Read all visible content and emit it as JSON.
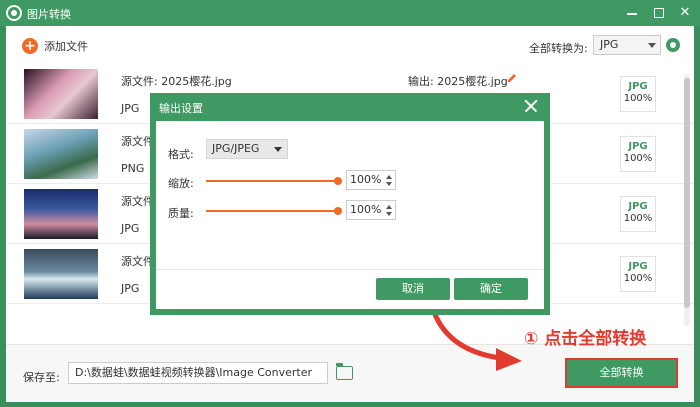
{
  "window": {
    "title": "图片转换",
    "minimize_icon": "minimize-icon",
    "maximize_icon": "maximize-icon",
    "close_icon": "close-icon"
  },
  "toolbar": {
    "add_files_label": "添加文件",
    "convert_all_to_label": "全部转换为:",
    "format_value": "JPG"
  },
  "files": [
    {
      "source": "源文件: 2025樱花.jpg",
      "format": "JPG",
      "output": "输出: 2025樱花.jpg",
      "badge_format": "JPG",
      "badge_quality": "100%"
    },
    {
      "source": "源文件",
      "format": "PNG",
      "output": "",
      "badge_format": "JPG",
      "badge_quality": "100%"
    },
    {
      "source": "源文件",
      "format": "JPG",
      "output": "",
      "badge_format": "JPG",
      "badge_quality": "100%"
    },
    {
      "source": "源文件",
      "format": "JPG",
      "output": "",
      "badge_format": "JPG",
      "badge_quality": "100%"
    }
  ],
  "bottom": {
    "save_to_label": "保存至:",
    "save_path": "D:\\数据蛙\\数据蛙视频转换器\\Image Converter",
    "convert_all_button": "全部转换"
  },
  "annotation": "① 点击全部转换",
  "dialog": {
    "title": "输出设置",
    "format_label": "格式:",
    "format_value": "JPG/JPEG",
    "scale_label": "缩放:",
    "scale_value": "100%",
    "scale_level": 1.0,
    "quality_label": "质量:",
    "quality_value": "100%",
    "quality_level": 1.0,
    "cancel_button": "取消",
    "ok_button": "确定"
  },
  "colors": {
    "brand_green": "#3e9a62",
    "accent_orange": "#f06a25",
    "annotation_red": "#e23a2e"
  }
}
